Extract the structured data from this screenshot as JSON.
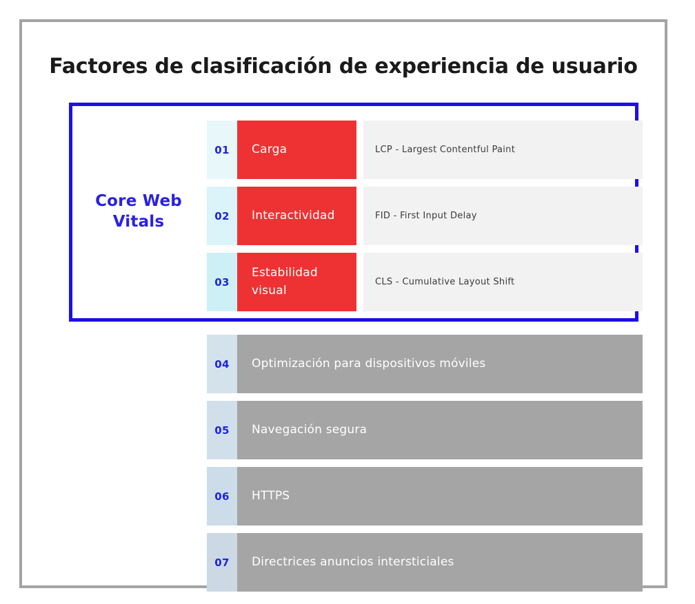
{
  "title": "Factores de clasificación de experiencia de usuario",
  "colors": {
    "frame_border": "#a3a3a3",
    "highlight_border": "#1e0ee6",
    "group_label": "#2a21df",
    "number_text": "#1f24e0",
    "bar_red": "#ee3233",
    "bar_gray": "#a5a5a5",
    "desc_background": "#f2f2f2",
    "title_text": "#1a1a1a",
    "bar_text": "#ffffff"
  },
  "group": {
    "label": "Core Web Vitals",
    "label_line1": "Core Web",
    "label_line2": "Vitals"
  },
  "rows": [
    {
      "number": "01",
      "label": "Carga",
      "description": "LCP - Largest Contentful Paint",
      "bar_color": "#ee3233",
      "number_bg": "#e8f8fa",
      "in_group": true
    },
    {
      "number": "02",
      "label": "Interactividad",
      "description": "FID - First Input Delay",
      "bar_color": "#ee3233",
      "number_bg": "#daf4f9",
      "in_group": true
    },
    {
      "number": "03",
      "label": "Estabilidad visual",
      "description": "CLS - Cumulative Layout Shift",
      "bar_color": "#ee3233",
      "number_bg": "#cdf0f7",
      "in_group": true
    },
    {
      "number": "04",
      "label": "Optimización para dispositivos móviles",
      "description": "",
      "bar_color": "#a5a5a5",
      "number_bg": "#d4e2ec",
      "in_group": false
    },
    {
      "number": "05",
      "label": "Navegación segura",
      "description": "",
      "bar_color": "#a5a5a5",
      "number_bg": "#d0dfea",
      "in_group": false
    },
    {
      "number": "06",
      "label": "HTTPS",
      "description": "",
      "bar_color": "#a5a5a5",
      "number_bg": "#ccdce8",
      "in_group": false
    },
    {
      "number": "07",
      "label": "Directrices anuncios intersticiales",
      "description": "",
      "bar_color": "#a5a5a5",
      "number_bg": "#ccd9e4",
      "in_group": false
    }
  ]
}
